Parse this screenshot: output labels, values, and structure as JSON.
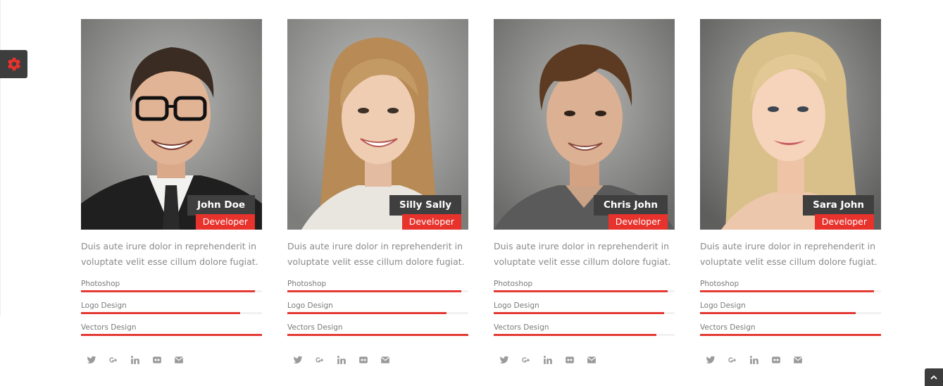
{
  "members": [
    {
      "name": "John Doe",
      "role": "Developer",
      "description": "Duis aute irure dolor in reprehenderit in voluptate velit esse cillum dolore fugiat.",
      "skills": [
        {
          "label": "Photoshop",
          "level": 0.96
        },
        {
          "label": "Logo Design",
          "level": 0.88
        },
        {
          "label": "Vectors Design",
          "level": 1.0
        }
      ],
      "socials": [
        "twitter-icon",
        "google-plus-icon",
        "linkedin-icon",
        "flickr-icon",
        "email-icon"
      ]
    },
    {
      "name": "Silly Sally",
      "role": "Developer",
      "description": "Duis aute irure dolor in reprehenderit in voluptate velit esse cillum dolore fugiat.",
      "skills": [
        {
          "label": "Photoshop",
          "level": 0.96
        },
        {
          "label": "Logo Design",
          "level": 0.88
        },
        {
          "label": "Vectors Design",
          "level": 1.0
        }
      ],
      "socials": [
        "twitter-icon",
        "google-plus-icon",
        "linkedin-icon",
        "flickr-icon",
        "email-icon"
      ]
    },
    {
      "name": "Chris John",
      "role": "Developer",
      "description": "Duis aute irure dolor in reprehenderit in voluptate velit esse cillum dolore fugiat.",
      "skills": [
        {
          "label": "Photoshop",
          "level": 0.96
        },
        {
          "label": "Logo Design",
          "level": 0.94
        },
        {
          "label": "Vectors Design",
          "level": 0.9
        }
      ],
      "socials": [
        "twitter-icon",
        "google-plus-icon",
        "linkedin-icon",
        "flickr-icon",
        "email-icon"
      ]
    },
    {
      "name": "Sara John",
      "role": "Developer",
      "description": "Duis aute irure dolor in reprehenderit in voluptate velit esse cillum dolore fugiat.",
      "skills": [
        {
          "label": "Photoshop",
          "level": 0.96
        },
        {
          "label": "Logo Design",
          "level": 0.86
        },
        {
          "label": "Vectors Design",
          "level": 1.0
        }
      ],
      "socials": [
        "twitter-icon",
        "google-plus-icon",
        "linkedin-icon",
        "flickr-icon",
        "email-icon"
      ]
    }
  ],
  "colors": {
    "accent": "#e43a34",
    "name_label_bg": "#3f3f3f",
    "social_icon": "#9a9a9a",
    "settings_tab_bg": "#3d3d3d",
    "settings_icon": "#e8322c"
  },
  "icons": {
    "settings": "gear-icon",
    "back_to_top": "chevron-up-icon"
  }
}
